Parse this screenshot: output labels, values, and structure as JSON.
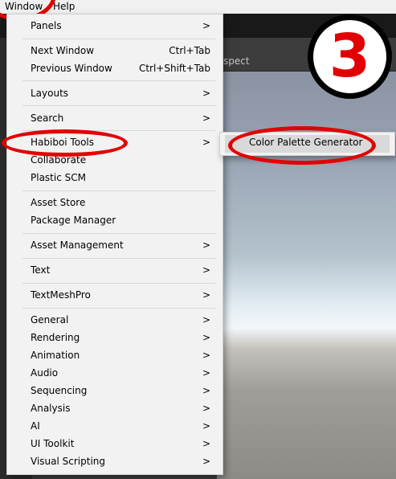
{
  "menubar": {
    "window": "Window",
    "help": "Help"
  },
  "scene_tab": {
    "label": "spect"
  },
  "badge": {
    "number": "3"
  },
  "window_menu": {
    "panels": "Panels",
    "next_window": {
      "label": "Next Window",
      "shortcut": "Ctrl+Tab"
    },
    "previous_window": {
      "label": "Previous Window",
      "shortcut": "Ctrl+Shift+Tab"
    },
    "layouts": "Layouts",
    "search": "Search",
    "habiboi_tools": "Habiboi Tools",
    "collaborate": "Collaborate",
    "plastic_scm": "Plastic SCM",
    "asset_store": "Asset Store",
    "package_manager": "Package Manager",
    "asset_management": "Asset Management",
    "text": "Text",
    "textmeshpro": "TextMeshPro",
    "general": "General",
    "rendering": "Rendering",
    "animation": "Animation",
    "audio": "Audio",
    "sequencing": "Sequencing",
    "analysis": "Analysis",
    "ai": "AI",
    "ui_toolkit": "UI Toolkit",
    "visual_scripting": "Visual Scripting",
    "arrow_glyph": ">"
  },
  "submenu": {
    "color_palette_generator": "Color Palette Generator"
  },
  "colors": {
    "annotation_red": "#e30000",
    "menu_bg": "#f2f2f2",
    "highlight": "#d9d9d9"
  }
}
